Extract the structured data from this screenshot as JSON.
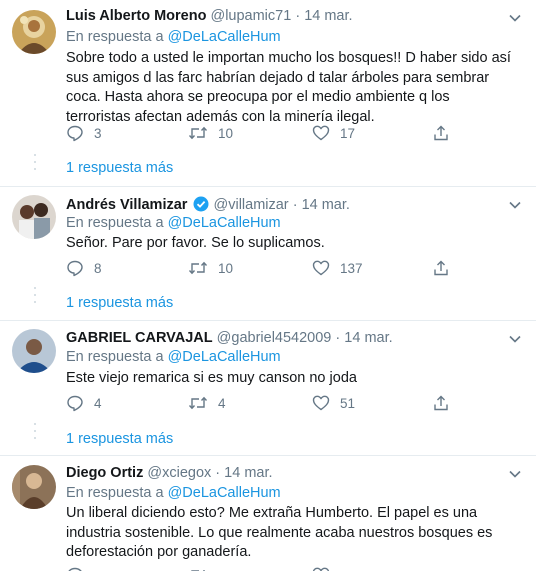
{
  "tweets": [
    {
      "name": "Luis Alberto Moreno",
      "handle": "@lupamic71",
      "date": "14 mar.",
      "reply_prefix": "En respuesta a",
      "reply_to": "@DeLaCalleHum",
      "text": "Sobre todo a usted le importan mucho los bosques!! D haber sido así sus amigos d las farc habrían dejado d talar árboles para sembrar coca. Hasta ahora se preocupa por el medio ambiente q los terroristas afectan además con la minería ilegal.",
      "replies": "3",
      "retweets": "10",
      "likes": "17",
      "more": "1 respuesta más",
      "verified": false
    },
    {
      "name": "Andrés Villamizar",
      "handle": "@villamizar",
      "date": "14 mar.",
      "reply_prefix": "En respuesta a",
      "reply_to": "@DeLaCalleHum",
      "text": "Señor. Pare por favor. Se lo suplicamos.",
      "replies": "8",
      "retweets": "10",
      "likes": "137",
      "more": "1 respuesta más",
      "verified": true
    },
    {
      "name": "GABRIEL CARVAJAL",
      "handle": "@gabriel4542009",
      "date": "14 mar.",
      "reply_prefix": "En respuesta a",
      "reply_to": "@DeLaCalleHum",
      "text": "Este viejo remarica si es muy canson no joda",
      "replies": "4",
      "retweets": "4",
      "likes": "51",
      "more": "1 respuesta más",
      "verified": false
    },
    {
      "name": "Diego Ortiz",
      "handle": "@xciegox",
      "date": "14 mar.",
      "reply_prefix": "En respuesta a",
      "reply_to": "@DeLaCalleHum",
      "text": "Un liberal diciendo esto? Me extraña Humberto. El papel es una industria sostenible. Lo que realmente acaba nuestros bosques es deforestación por ganadería.",
      "replies": "",
      "retweets": "",
      "likes": "",
      "more": "",
      "verified": false
    }
  ],
  "colors": {
    "link": "#1b95e0",
    "muted": "#657786",
    "verified": "#1da1f2",
    "divider": "#e6ecf0"
  }
}
